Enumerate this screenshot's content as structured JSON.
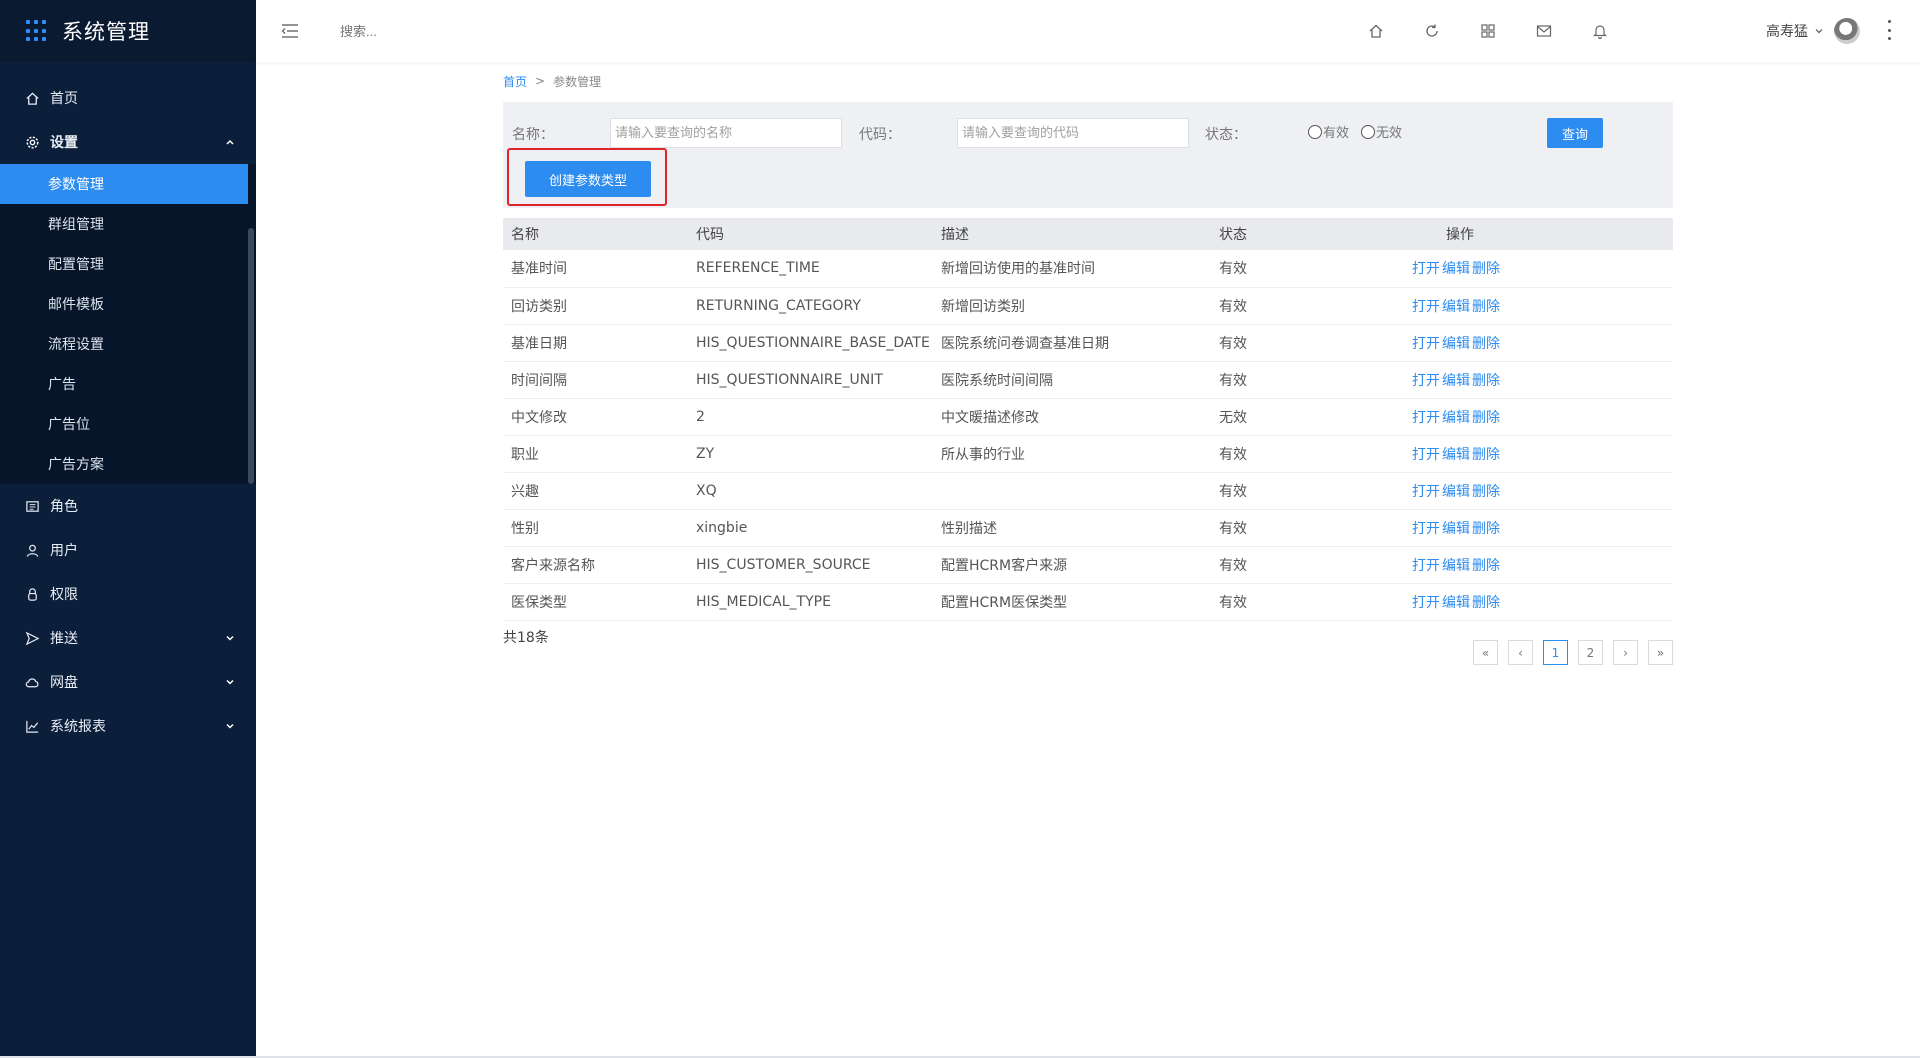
{
  "app": {
    "title": "系统管理"
  },
  "sidebar": {
    "items": [
      {
        "label": "首页",
        "icon": "home-icon"
      },
      {
        "label": "设置",
        "icon": "gear-icon",
        "expanded": true,
        "children": [
          "参数管理",
          "群组管理",
          "配置管理",
          "邮件模板",
          "流程设置",
          "广告",
          "广告位",
          "广告方案"
        ],
        "active_child": "参数管理"
      },
      {
        "label": "角色",
        "icon": "role-icon"
      },
      {
        "label": "用户",
        "icon": "user-icon"
      },
      {
        "label": "权限",
        "icon": "lock-icon"
      },
      {
        "label": "推送",
        "icon": "send-icon",
        "has_caret": true
      },
      {
        "label": "网盘",
        "icon": "cloud-icon",
        "has_caret": true
      },
      {
        "label": "系统报表",
        "icon": "chart-icon",
        "has_caret": true
      }
    ]
  },
  "header": {
    "search_placeholder": "搜索...",
    "icons": [
      "home-icon",
      "refresh-icon",
      "apps-icon",
      "mail-icon",
      "bell-icon"
    ],
    "user_name": "高寿猛"
  },
  "breadcrumb": {
    "home": "首页",
    "separator": ">",
    "current": "参数管理"
  },
  "filter": {
    "name_label": "名称：",
    "name_placeholder": "请输入要查询的名称",
    "code_label": "代码：",
    "code_placeholder": "请输入要查询的代码",
    "status_label": "状态：",
    "status_options": [
      "有效",
      "无效"
    ],
    "query_button": "查询",
    "create_button": "创建参数类型"
  },
  "table": {
    "columns": [
      "名称",
      "代码",
      "描述",
      "状态",
      "操作"
    ],
    "actions": [
      "打开",
      "编辑",
      "删除"
    ],
    "rows": [
      [
        "基准时间",
        "REFERENCE_TIME",
        "新增回访使用的基准时间",
        "有效"
      ],
      [
        "回访类别",
        "RETURNING_CATEGORY",
        "新增回访类别",
        "有效"
      ],
      [
        "基准日期",
        "HIS_QUESTIONNAIRE_BASE_DATE",
        "医院系统问卷调查基准日期",
        "有效"
      ],
      [
        "时间间隔",
        "HIS_QUESTIONNAIRE_UNIT",
        "医院系统时间间隔",
        "有效"
      ],
      [
        "中文修改",
        "2",
        "中文暖描述修改",
        "无效"
      ],
      [
        "职业",
        "ZY",
        "所从事的行业",
        "有效"
      ],
      [
        "兴趣",
        "XQ",
        "",
        "有效"
      ],
      [
        "性别",
        "xingbie",
        "性别描述",
        "有效"
      ],
      [
        "客户来源名称",
        "HIS_CUSTOMER_SOURCE",
        "配置HCRM客户来源",
        "有效"
      ],
      [
        "医保类型",
        "HIS_MEDICAL_TYPE",
        "配置HCRM医保类型",
        "有效"
      ]
    ]
  },
  "pagination": {
    "total_text": "共18条",
    "first": "«",
    "prev": "‹",
    "pages": [
      "1",
      "2"
    ],
    "current": "1",
    "next": "›",
    "last": "»"
  },
  "colors": {
    "sidebar_bg": "#0b1f3a",
    "accent": "#2d8cf0",
    "highlight_border": "#e0262b"
  }
}
